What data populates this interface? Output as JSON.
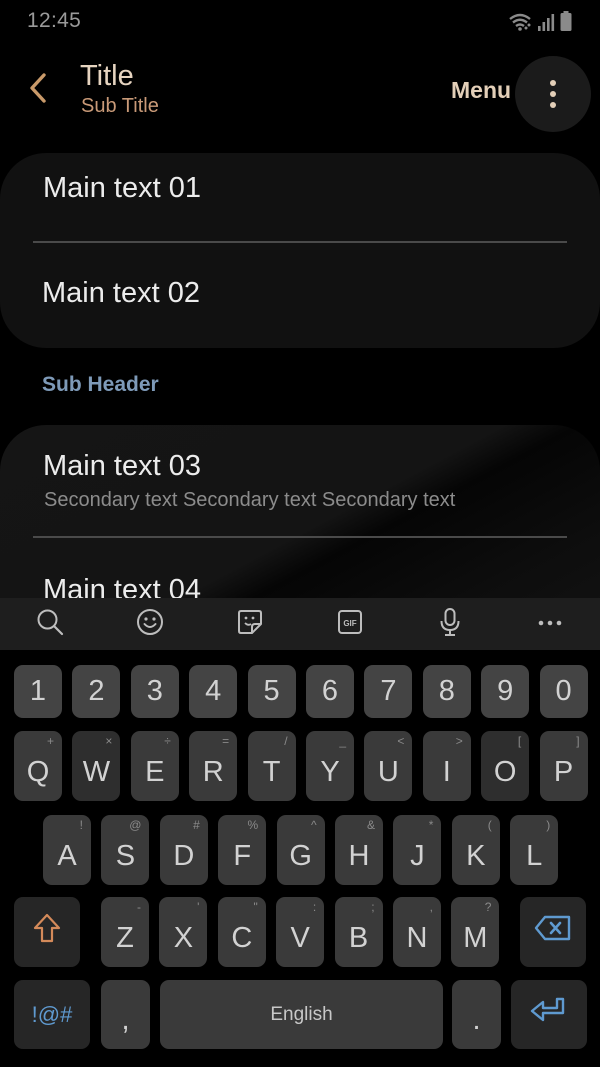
{
  "status_bar": {
    "time": "12:45",
    "icons": [
      "wifi-icon",
      "signal-icon",
      "battery-icon"
    ]
  },
  "app_bar": {
    "back_icon": "chevron-left-icon",
    "title": "Title",
    "subtitle": "Sub Title",
    "menu_label": "Menu",
    "more_icon": "more-vertical-icon"
  },
  "colors": {
    "accent_title": "#e6d4c0",
    "accent_subtitle": "#c99a78",
    "sub_header": "#7e9ab8",
    "keyboard_blue": "#5f9ad0",
    "shift_orange": "#d48a5a"
  },
  "list_group_1": {
    "items": [
      {
        "main": "Main text 01"
      },
      {
        "main": "Main text 02"
      }
    ]
  },
  "sub_header": "Sub Header",
  "list_group_2": {
    "items": [
      {
        "main": "Main text 03",
        "secondary": "Secondary text Secondary text Secondary text"
      },
      {
        "main": "Main text 04"
      }
    ]
  },
  "keyboard": {
    "toolbar": [
      "search-icon",
      "emoji-icon",
      "sticker-icon",
      "gif-icon",
      "microphone-icon",
      "more-horizontal-icon"
    ],
    "gif_label": "GIF",
    "number_row": [
      "1",
      "2",
      "3",
      "4",
      "5",
      "6",
      "7",
      "8",
      "9",
      "0"
    ],
    "row1": [
      {
        "key": "Q",
        "hint": "+"
      },
      {
        "key": "W",
        "hint": "×"
      },
      {
        "key": "E",
        "hint": "÷"
      },
      {
        "key": "R",
        "hint": "="
      },
      {
        "key": "T",
        "hint": "/"
      },
      {
        "key": "Y",
        "hint": "_"
      },
      {
        "key": "U",
        "hint": "<"
      },
      {
        "key": "I",
        "hint": ">"
      },
      {
        "key": "O",
        "hint": "["
      },
      {
        "key": "P",
        "hint": "]"
      }
    ],
    "row2": [
      {
        "key": "A",
        "hint": "!"
      },
      {
        "key": "S",
        "hint": "@"
      },
      {
        "key": "D",
        "hint": "#"
      },
      {
        "key": "F",
        "hint": "%"
      },
      {
        "key": "G",
        "hint": "^"
      },
      {
        "key": "H",
        "hint": "&"
      },
      {
        "key": "J",
        "hint": "*"
      },
      {
        "key": "K",
        "hint": "("
      },
      {
        "key": "L",
        "hint": ")"
      }
    ],
    "row3": [
      {
        "key": "Z",
        "hint": "-"
      },
      {
        "key": "X",
        "hint": "'"
      },
      {
        "key": "C",
        "hint": "\""
      },
      {
        "key": "V",
        "hint": ":"
      },
      {
        "key": "B",
        "hint": ";"
      },
      {
        "key": "N",
        "hint": ","
      },
      {
        "key": "M",
        "hint": "?"
      }
    ],
    "symbols_label": "!@#",
    "comma": ",",
    "space_label": "English",
    "period": ".",
    "shift_icon": "shift-icon",
    "backspace_icon": "backspace-icon",
    "enter_icon": "enter-icon"
  }
}
